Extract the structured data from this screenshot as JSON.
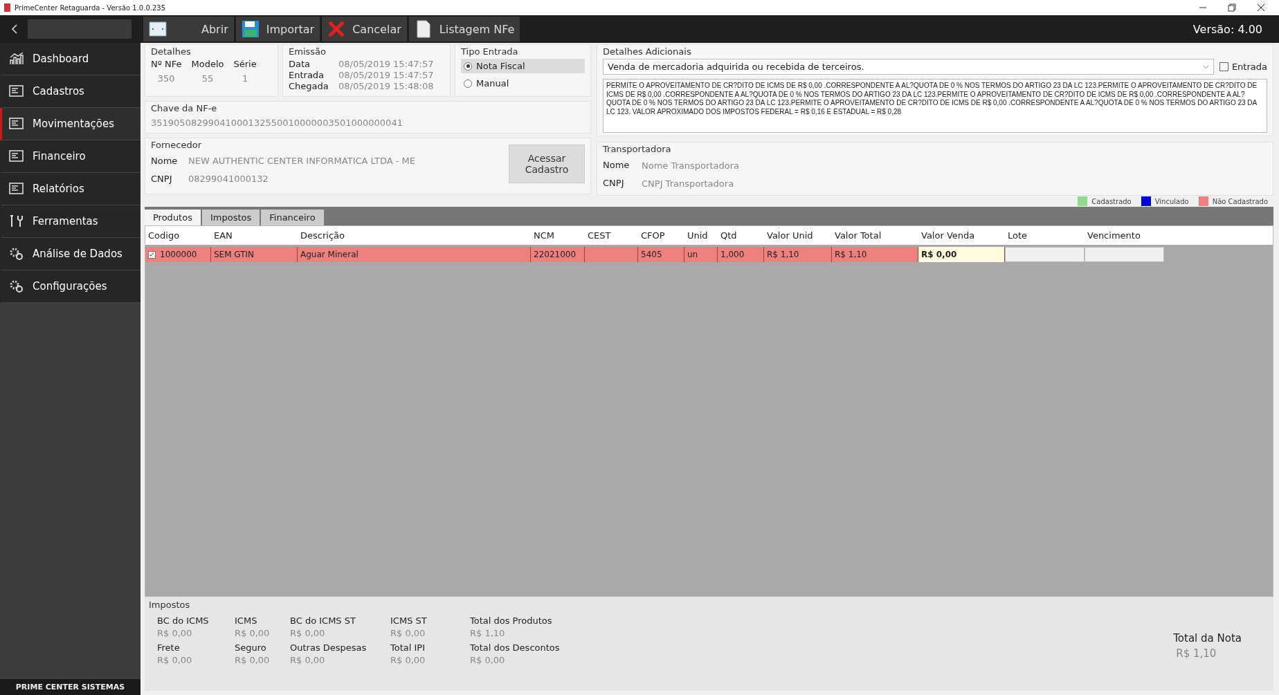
{
  "window": {
    "title": "PrimeCenter Retaguarda - Versão 1.0.0.235"
  },
  "toolbar": {
    "buttons": [
      {
        "label": "Abrir"
      },
      {
        "label": "Importar"
      },
      {
        "label": "Cancelar"
      },
      {
        "label": "Listagem NFe"
      }
    ],
    "version": "Versão: 4.00"
  },
  "sidebar": {
    "items": [
      {
        "label": "Dashboard",
        "selected": false
      },
      {
        "label": "Cadastros",
        "selected": false
      },
      {
        "label": "Movimentações",
        "selected": true
      },
      {
        "label": "Financeiro",
        "selected": false
      },
      {
        "label": "Relatórios",
        "selected": false
      },
      {
        "label": "Ferramentas",
        "selected": false
      },
      {
        "label": "Análise de Dados",
        "selected": false
      },
      {
        "label": "Configurações",
        "selected": false
      }
    ],
    "footer": "PRIME CENTER SISTEMAS"
  },
  "detalhes": {
    "legend": "Detalhes",
    "fields": [
      {
        "label": "Nº NFe",
        "value": "350"
      },
      {
        "label": "Modelo",
        "value": "55"
      },
      {
        "label": "Série",
        "value": "1"
      }
    ]
  },
  "emissao": {
    "legend": "Emissão",
    "rows": [
      {
        "label": "Data",
        "value": "08/05/2019 15:47:57"
      },
      {
        "label": "Entrada",
        "value": "08/05/2019 15:47:57"
      },
      {
        "label": "Chegada",
        "value": "08/05/2019 15:48:08"
      }
    ]
  },
  "tipo_entrada": {
    "legend": "Tipo Entrada",
    "options": [
      {
        "label": "Nota Fiscal",
        "selected": true
      },
      {
        "label": "Manual",
        "selected": false
      }
    ]
  },
  "chave": {
    "legend": "Chave da NF-e",
    "value": "35190508299041000132550010000003501000000041"
  },
  "fornecedor": {
    "legend": "Fornecedor",
    "nome_label": "Nome",
    "nome": "NEW AUTHENTIC CENTER INFORMATICA LTDA - ME",
    "cnpj_label": "CNPJ",
    "cnpj": "08299041000132",
    "button": "Acessar Cadastro"
  },
  "detalhes_adicionais": {
    "legend": "Detalhes Adicionais",
    "select": "Venda de mercadoria adquirida ou recebida de terceiros.",
    "checkbox": {
      "label": "Entrada",
      "checked": false
    },
    "text": "PERMITE O APROVEITAMENTO DE CR?DITO DE ICMS DE R$ 0,00 .CORRESPONDENTE A AL?QUOTA DE 0 % NOS TERMOS DO ARTIGO 23 DA LC 123.PERMITE O APROVEITAMENTO DE CR?DITO DE ICMS DE R$ 0,00 .CORRESPONDENTE A AL?QUOTA DE 0 % NOS TERMOS DO ARTIGO 23 DA LC 123.PERMITE O APROVEITAMENTO DE CR?DITO DE ICMS DE R$ 0,00 .CORRESPONDENTE A AL?QUOTA DE 0 % NOS TERMOS DO ARTIGO 23 DA LC 123.PERMITE O APROVEITAMENTO DE CR?DITO DE ICMS DE R$ 0,00 .CORRESPONDENTE A AL?QUOTA DE 0 % NOS TERMOS DO ARTIGO 23 DA LC 123. VALOR APROXIMADO DOS IMPOSTOS FEDERAL = R$ 0,16 E ESTADUAL = R$ 0,28"
  },
  "transportadora": {
    "legend": "Transportadora",
    "rows": [
      {
        "label": "Nome",
        "placeholder": "Nome Transportadora"
      },
      {
        "label": "CNPJ",
        "placeholder": "CNPJ Transportadora"
      }
    ]
  },
  "legend": [
    {
      "label": "Cadastrado",
      "color": "#8fdc8f"
    },
    {
      "label": "Vinculado",
      "color": "#0000e0"
    },
    {
      "label": "Não Cadastrado",
      "color": "#ee8080"
    }
  ],
  "tabs": [
    {
      "label": "Produtos",
      "selected": true
    },
    {
      "label": "Impostos",
      "selected": false
    },
    {
      "label": "Financeiro",
      "selected": false
    }
  ],
  "table": {
    "columns": [
      "Codigo",
      "EAN",
      "Descrição",
      "NCM",
      "CEST",
      "CFOP",
      "Unid",
      "Qtd",
      "Valor Unid",
      "Valor Total",
      "Valor Venda",
      "Lote",
      "Vencimento"
    ],
    "rows": [
      {
        "checked": true,
        "color": "#ee8080",
        "codigo": "1000000",
        "ean": "SEM GTIN",
        "descricao": "Aguar Mineral",
        "ncm": "22021000",
        "cfop": "5405",
        "unid": "un",
        "qtd": "1,000",
        "valor_unid": "R$ 1,10",
        "valor_total": "R$ 1,10",
        "valor_venda": "R$ 0,00"
      }
    ]
  },
  "impostos": {
    "legend": "Impostos",
    "items": [
      {
        "label": "BC do ICMS",
        "value": "R$ 0,00"
      },
      {
        "label": "ICMS",
        "value": "R$ 0,00"
      },
      {
        "label": "BC do ICMS ST",
        "value": "R$ 0,00"
      },
      {
        "label": "ICMS ST",
        "value": "R$ 0,00"
      },
      {
        "label": "Total dos Produtos",
        "value": "R$ 1,10"
      },
      {
        "label": "Frete",
        "value": "R$ 0,00"
      },
      {
        "label": "Seguro",
        "value": "R$ 0,00"
      },
      {
        "label": "Outras Despesas",
        "value": "R$ 0,00"
      },
      {
        "label": "Total IPI",
        "value": "R$ 0,00"
      },
      {
        "label": "Total dos Descontos",
        "value": "R$ 0,00"
      }
    ],
    "total_label": "Total da Nota",
    "total_value": "R$ 1,10"
  }
}
